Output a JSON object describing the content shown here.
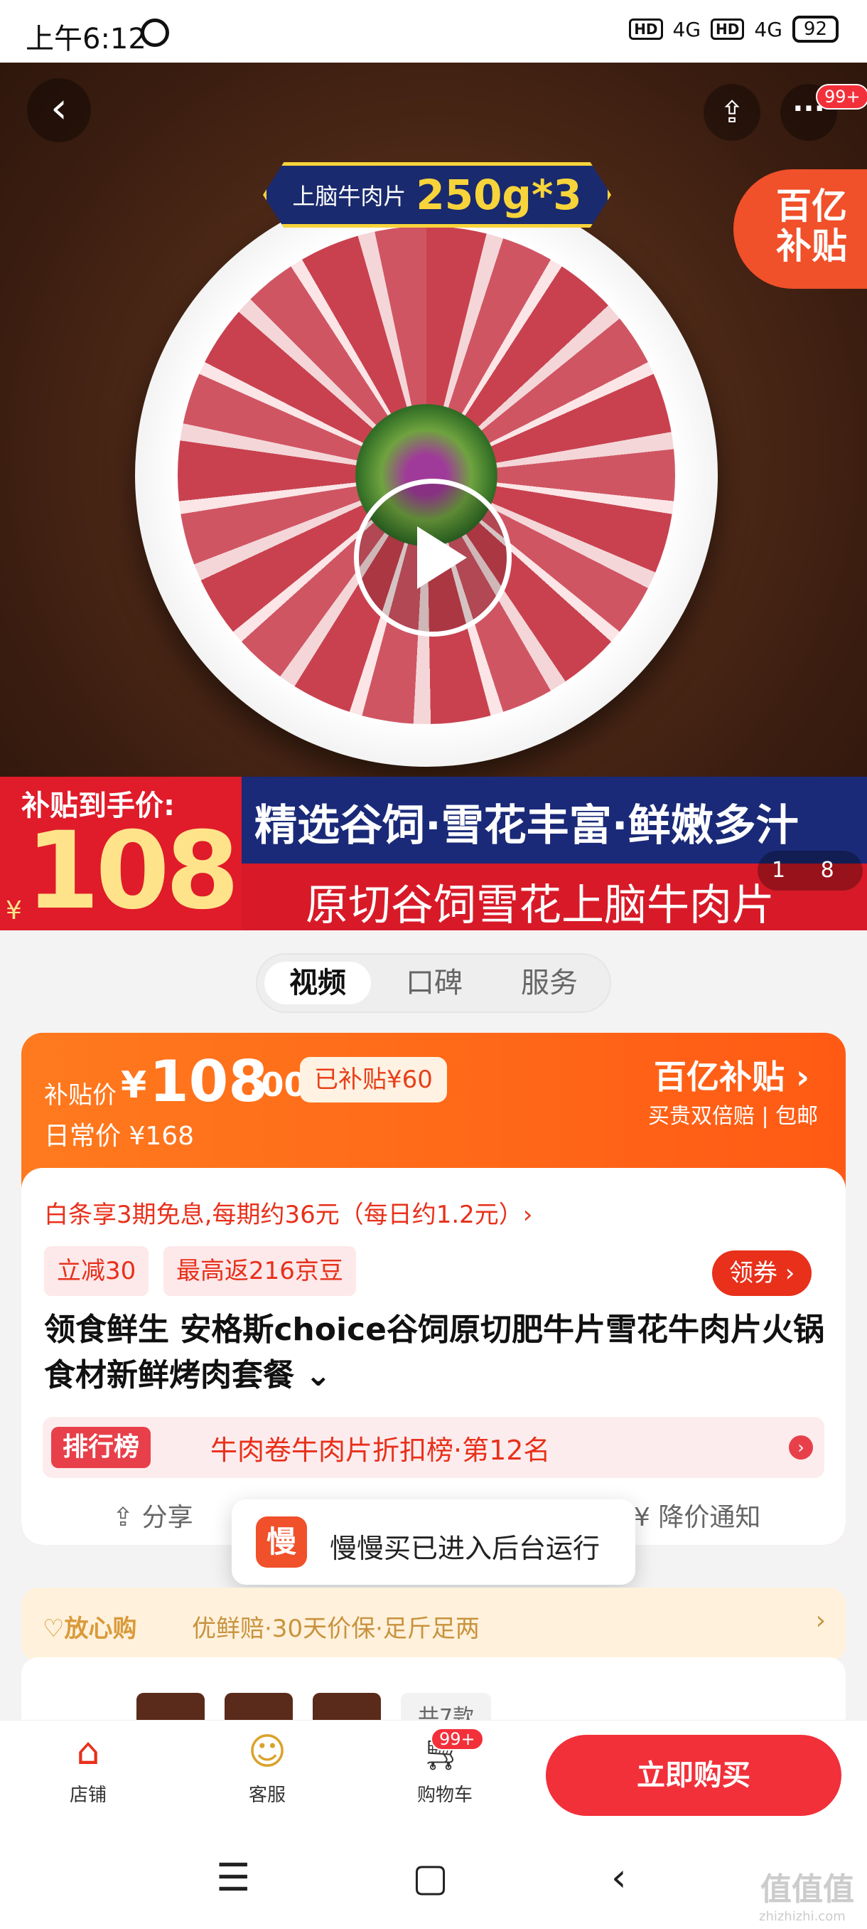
{
  "status_bar": {
    "time": "上午6:12",
    "hd1": "HD",
    "net1": "4G",
    "hd2": "HD",
    "net2": "4G",
    "battery": "92"
  },
  "hero": {
    "tag_label": "上脑牛肉片",
    "tag_weight": "250g*3",
    "more_badge": "99+",
    "corner_badge": "百亿\n补贴",
    "banner_label": "补贴到手价:",
    "banner_yen": "¥",
    "banner_price": "108",
    "banner_line1": "精选谷饲·雪花丰富·鲜嫩多汁",
    "banner_line2": "原切谷饲雪花上脑牛肉片",
    "pager": "1 8"
  },
  "tabs": [
    "视频",
    "口碑",
    "服务"
  ],
  "price_card": {
    "label": "补贴价",
    "yen": "¥",
    "price": "108",
    "cents": ".00",
    "subsidized": "已补贴¥60",
    "regular": "日常价 ¥168",
    "logo": "百亿补贴 ›",
    "logo_sub": "买贵双倍赔 | 包邮",
    "baitiao": "白条享3期免息,每期约36元（每日约1.2元）›",
    "chip1": "立减30",
    "chip2": "最高返216京豆",
    "coupon": "领券 ›",
    "title": "领食鲜生 安格斯choice谷饲原切肥牛片雪花牛肉片火锅食材新鲜烤肉套餐 ⌄",
    "rank_badge": "排行榜",
    "rank_text": "牛肉卷牛肉片折扣榜·第12名",
    "share": "分享",
    "price_notify": "降价通知"
  },
  "toast": {
    "icon": "慢",
    "text": "慢慢买已进入后台运行"
  },
  "assurance": {
    "title": "放心购",
    "items": "优鲜赔·30天价保·足斤足两",
    "arrow": "›"
  },
  "spec": {
    "more": "共7款"
  },
  "bottom_bar": {
    "shop": "店铺",
    "service": "客服",
    "cart": "购物车",
    "cart_badge": "99+",
    "buy": "立即购买"
  },
  "watermark": {
    "text": "值值值",
    "url": "zhizhizhi.com"
  },
  "colors": {
    "accent": "#f2303a",
    "orange": "#ff6a14"
  }
}
